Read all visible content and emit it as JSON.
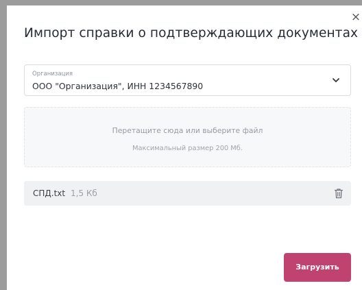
{
  "dialog": {
    "title": "Импорт справки о подтверждающих документах",
    "close_glyph": "×"
  },
  "organization_select": {
    "label": "Организация",
    "value": "ООО \"Организация\", ИНН 1234567890",
    "icon": "chevron-down-icon"
  },
  "dropzone": {
    "main_text": "Перетащите сюда или выберите файл",
    "hint_text": "Максимальный размер 200 Мб."
  },
  "file": {
    "name": "СПД.txt",
    "size": "1,5 Кб",
    "delete_icon": "trash-icon"
  },
  "actions": {
    "submit_label": "Загрузить"
  },
  "colors": {
    "accent": "#c0436f",
    "frame": "#9c9c9c",
    "file_row_bg": "#f0f1f3",
    "dropzone_bg": "#f7f8f9"
  }
}
